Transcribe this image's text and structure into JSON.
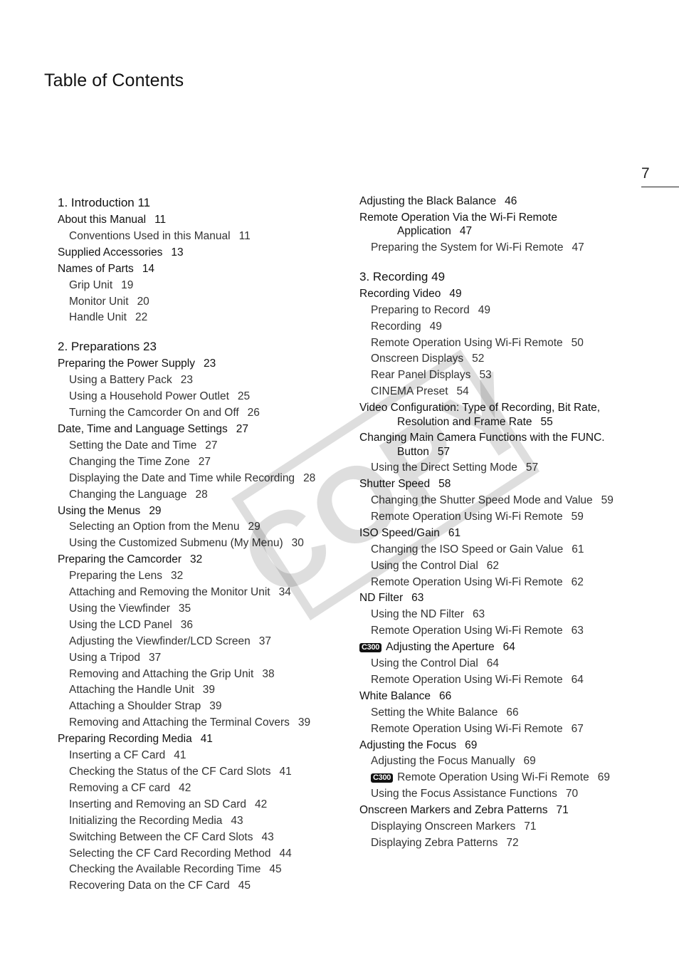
{
  "title": "Table of Contents",
  "page_number": "7",
  "watermark": "COPY",
  "left_column": [
    {
      "type": "chapter",
      "text": "1. Introduction 11"
    },
    {
      "type": "l1",
      "text": "About this Manual",
      "page": "11"
    },
    {
      "type": "l2",
      "text": "Conventions Used in this Manual",
      "page": "11"
    },
    {
      "type": "l1",
      "text": "Supplied Accessories",
      "page": "13"
    },
    {
      "type": "l1",
      "text": "Names of Parts",
      "page": "14"
    },
    {
      "type": "l2",
      "text": "Grip Unit",
      "page": "19"
    },
    {
      "type": "l2",
      "text": "Monitor Unit",
      "page": "20"
    },
    {
      "type": "l2",
      "text": "Handle Unit",
      "page": "22"
    },
    {
      "type": "chapter",
      "text": "2. Preparations 23"
    },
    {
      "type": "l1",
      "text": "Preparing the Power Supply",
      "page": "23"
    },
    {
      "type": "l2",
      "text": "Using a Battery Pack",
      "page": "23"
    },
    {
      "type": "l2",
      "text": "Using a Household Power Outlet",
      "page": "25"
    },
    {
      "type": "l2",
      "text": "Turning the Camcorder On and Off",
      "page": "26"
    },
    {
      "type": "l1",
      "text": "Date, Time and Language Settings",
      "page": "27"
    },
    {
      "type": "l2",
      "text": "Setting the Date and Time",
      "page": "27"
    },
    {
      "type": "l2",
      "text": "Changing the Time Zone",
      "page": "27"
    },
    {
      "type": "l2",
      "text": "Displaying the Date and Time while Recording",
      "page": "28"
    },
    {
      "type": "l2",
      "text": "Changing the Language",
      "page": "28"
    },
    {
      "type": "l1",
      "text": "Using the Menus",
      "page": "29"
    },
    {
      "type": "l2",
      "text": "Selecting an Option from the Menu",
      "page": "29"
    },
    {
      "type": "l2",
      "text": "Using the Customized Submenu (My Menu)",
      "page": "30"
    },
    {
      "type": "l1",
      "text": "Preparing the Camcorder",
      "page": "32"
    },
    {
      "type": "l2",
      "text": "Preparing the Lens",
      "page": "32"
    },
    {
      "type": "l2",
      "text": "Attaching and Removing the Monitor Unit",
      "page": "34"
    },
    {
      "type": "l2",
      "text": "Using the Viewfinder",
      "page": "35"
    },
    {
      "type": "l2",
      "text": "Using the LCD Panel",
      "page": "36"
    },
    {
      "type": "l2",
      "text": "Adjusting the Viewfinder/LCD Screen",
      "page": "37"
    },
    {
      "type": "l2",
      "text": "Using a Tripod",
      "page": "37"
    },
    {
      "type": "l2",
      "text": "Removing and Attaching the Grip Unit",
      "page": "38"
    },
    {
      "type": "l2",
      "text": "Attaching the Handle Unit",
      "page": "39"
    },
    {
      "type": "l2",
      "text": "Attaching a Shoulder Strap",
      "page": "39"
    },
    {
      "type": "l2",
      "text": "Removing and Attaching the Terminal Covers",
      "page": "39"
    },
    {
      "type": "l1",
      "text": "Preparing Recording Media",
      "page": "41"
    },
    {
      "type": "l2",
      "text": "Inserting a CF Card",
      "page": "41"
    },
    {
      "type": "l2",
      "text": "Checking the Status of the CF Card Slots",
      "page": "41"
    },
    {
      "type": "l2",
      "text": "Removing a CF card",
      "page": "42"
    },
    {
      "type": "l2",
      "text": "Inserting and Removing an SD Card",
      "page": "42"
    },
    {
      "type": "l2",
      "text": "Initializing the Recording Media",
      "page": "43"
    },
    {
      "type": "l2",
      "text": "Switching Between the CF Card Slots",
      "page": "43"
    },
    {
      "type": "l2",
      "text": "Selecting the CF Card Recording Method",
      "page": "44"
    },
    {
      "type": "l2",
      "text": "Checking the Available Recording Time",
      "page": "45"
    },
    {
      "type": "l2",
      "text": "Recovering Data on the CF Card",
      "page": "45"
    }
  ],
  "right_column": [
    {
      "type": "l1",
      "text": "Adjusting the Black Balance",
      "page": "46"
    },
    {
      "type": "l1wrap",
      "text": "Remote Operation Via the Wi-Fi Remote",
      "cont": "Application",
      "page": "47"
    },
    {
      "type": "l2",
      "text": "Preparing the System for Wi-Fi Remote",
      "page": "47"
    },
    {
      "type": "chapter",
      "text": "3. Recording 49"
    },
    {
      "type": "l1",
      "text": "Recording Video",
      "page": "49"
    },
    {
      "type": "l2",
      "text": "Preparing to Record",
      "page": "49"
    },
    {
      "type": "l2",
      "text": "Recording",
      "page": "49"
    },
    {
      "type": "l2",
      "text": "Remote Operation Using Wi-Fi Remote",
      "page": "50"
    },
    {
      "type": "l2",
      "text": "Onscreen Displays",
      "page": "52"
    },
    {
      "type": "l2",
      "text": "Rear Panel Displays",
      "page": "53"
    },
    {
      "type": "l2",
      "text": "CINEMA Preset",
      "page": "54"
    },
    {
      "type": "l1wrap",
      "text": "Video Configuration: Type of Recording, Bit Rate,",
      "cont": "Resolution and Frame Rate",
      "page": "55"
    },
    {
      "type": "l1wrap",
      "text": "Changing Main Camera Functions with the FUNC.",
      "cont": "Button",
      "page": "57"
    },
    {
      "type": "l2",
      "text": "Using the Direct Setting Mode",
      "page": "57"
    },
    {
      "type": "l1",
      "text": "Shutter Speed",
      "page": "58"
    },
    {
      "type": "l2",
      "text": "Changing the Shutter Speed Mode and Value",
      "page": "59"
    },
    {
      "type": "l2",
      "text": "Remote Operation Using Wi-Fi Remote",
      "page": "59"
    },
    {
      "type": "l1",
      "text": "ISO Speed/Gain",
      "page": "61"
    },
    {
      "type": "l2",
      "text": "Changing the ISO Speed or Gain Value",
      "page": "61"
    },
    {
      "type": "l2",
      "text": "Using the Control Dial",
      "page": "62"
    },
    {
      "type": "l2",
      "text": "Remote Operation Using Wi-Fi Remote",
      "page": "62"
    },
    {
      "type": "l1",
      "text": "ND Filter",
      "page": "63"
    },
    {
      "type": "l2",
      "text": "Using the ND Filter",
      "page": "63"
    },
    {
      "type": "l2",
      "text": "Remote Operation Using Wi-Fi Remote",
      "page": "63"
    },
    {
      "type": "l1",
      "badge": "C300",
      "text": "Adjusting the Aperture",
      "page": "64"
    },
    {
      "type": "l2",
      "text": "Using the Control Dial",
      "page": "64"
    },
    {
      "type": "l2",
      "text": "Remote Operation Using Wi-Fi Remote",
      "page": "64"
    },
    {
      "type": "l1",
      "text": "White Balance",
      "page": "66"
    },
    {
      "type": "l2",
      "text": "Setting the White Balance",
      "page": "66"
    },
    {
      "type": "l2",
      "text": "Remote Operation Using Wi-Fi Remote",
      "page": "67"
    },
    {
      "type": "l1",
      "text": "Adjusting the Focus",
      "page": "69"
    },
    {
      "type": "l2",
      "text": "Adjusting the Focus Manually",
      "page": "69"
    },
    {
      "type": "l2",
      "badge": "C300",
      "text": "Remote Operation Using Wi-Fi Remote",
      "page": "69"
    },
    {
      "type": "l2",
      "text": "Using the Focus Assistance Functions",
      "page": "70"
    },
    {
      "type": "l1",
      "text": "Onscreen Markers and Zebra Patterns",
      "page": "71"
    },
    {
      "type": "l2",
      "text": "Displaying Onscreen Markers",
      "page": "71"
    },
    {
      "type": "l2",
      "text": "Displaying Zebra Patterns",
      "page": "72"
    }
  ]
}
